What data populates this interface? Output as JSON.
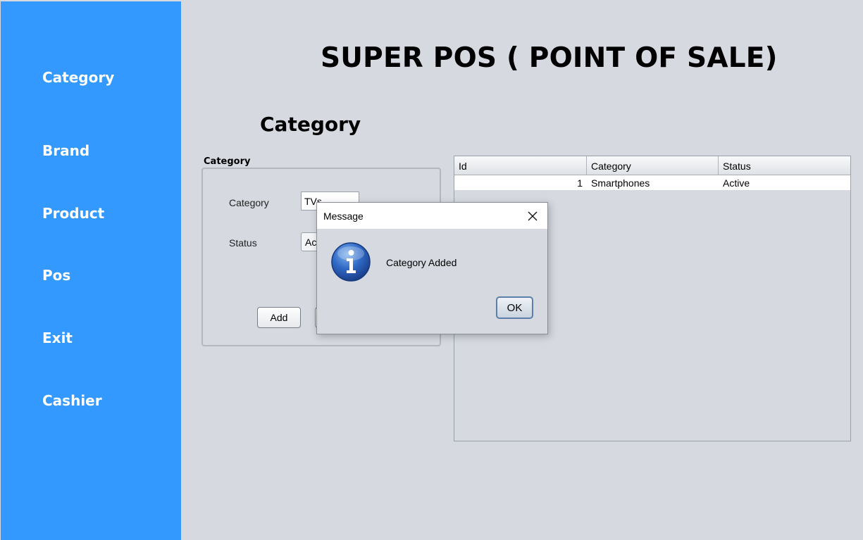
{
  "app": {
    "title": "SUPER POS ( POINT OF SALE)"
  },
  "sidebar": {
    "items": [
      {
        "label": "Category"
      },
      {
        "label": "Brand"
      },
      {
        "label": "Product"
      },
      {
        "label": "Pos"
      },
      {
        "label": "Exit"
      },
      {
        "label": "Cashier"
      }
    ]
  },
  "page": {
    "heading": "Category"
  },
  "form": {
    "legend": "Category",
    "category_label": "Category",
    "category_value": "TVs",
    "status_label": "Status",
    "status_value": "Active",
    "add_button": "Add"
  },
  "table": {
    "columns": [
      "Id",
      "Category",
      "Status"
    ],
    "rows": [
      {
        "id": "1",
        "category": "Smartphones",
        "status": "Active"
      }
    ]
  },
  "dialog": {
    "title": "Message",
    "message": "Category Added",
    "ok_button": "OK"
  },
  "colors": {
    "sidebar": "#3399ff",
    "background": "#d6d9e0"
  }
}
